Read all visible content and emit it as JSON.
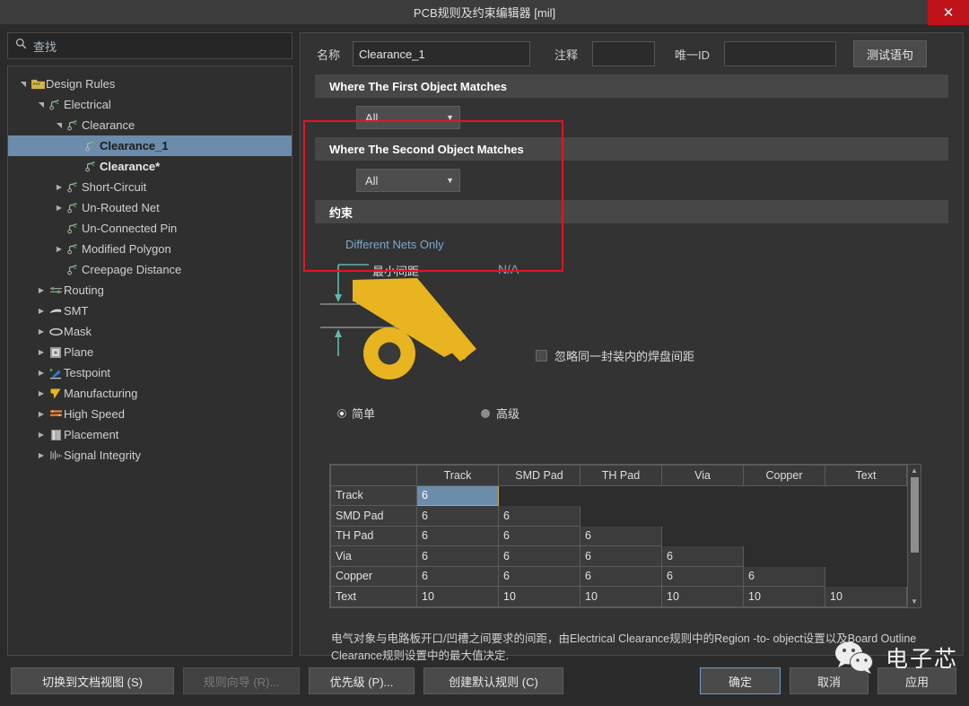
{
  "window": {
    "title": "PCB规则及约束编辑器 [mil]",
    "close_label": "✕"
  },
  "sidebar": {
    "search": {
      "placeholder": "查找",
      "value": "查找",
      "icon": "search-icon"
    },
    "tree": [
      {
        "label": "Design Rules",
        "depth": 0,
        "arrow": "down",
        "icon": "folder-icon",
        "state": "normal"
      },
      {
        "label": "Electrical",
        "depth": 1,
        "arrow": "down",
        "icon": "electrical-icon",
        "state": "normal"
      },
      {
        "label": "Clearance",
        "depth": 2,
        "arrow": "down",
        "icon": "rule-icon",
        "state": "normal"
      },
      {
        "label": "Clearance_1",
        "depth": 3,
        "arrow": "none",
        "icon": "rule-icon",
        "state": "selected"
      },
      {
        "label": "Clearance*",
        "depth": 3,
        "arrow": "none",
        "icon": "rule-icon",
        "state": "bold"
      },
      {
        "label": "Short-Circuit",
        "depth": 2,
        "arrow": "right",
        "icon": "rule-icon",
        "state": "normal"
      },
      {
        "label": "Un-Routed Net",
        "depth": 2,
        "arrow": "right",
        "icon": "rule-icon",
        "state": "normal"
      },
      {
        "label": "Un-Connected Pin",
        "depth": 2,
        "arrow": "none",
        "icon": "rule-icon",
        "state": "normal"
      },
      {
        "label": "Modified Polygon",
        "depth": 2,
        "arrow": "right",
        "icon": "rule-icon",
        "state": "normal"
      },
      {
        "label": "Creepage Distance",
        "depth": 2,
        "arrow": "none",
        "icon": "rule-icon",
        "state": "normal"
      },
      {
        "label": "Routing",
        "depth": 1,
        "arrow": "right",
        "icon": "routing-icon",
        "state": "normal"
      },
      {
        "label": "SMT",
        "depth": 1,
        "arrow": "right",
        "icon": "smt-icon",
        "state": "normal"
      },
      {
        "label": "Mask",
        "depth": 1,
        "arrow": "right",
        "icon": "mask-icon",
        "state": "normal"
      },
      {
        "label": "Plane",
        "depth": 1,
        "arrow": "right",
        "icon": "plane-icon",
        "state": "normal"
      },
      {
        "label": "Testpoint",
        "depth": 1,
        "arrow": "right",
        "icon": "testpoint-icon",
        "state": "normal"
      },
      {
        "label": "Manufacturing",
        "depth": 1,
        "arrow": "right",
        "icon": "manufacturing-icon",
        "state": "normal"
      },
      {
        "label": "High Speed",
        "depth": 1,
        "arrow": "right",
        "icon": "highspeed-icon",
        "state": "normal"
      },
      {
        "label": "Placement",
        "depth": 1,
        "arrow": "right",
        "icon": "placement-icon",
        "state": "normal"
      },
      {
        "label": "Signal Integrity",
        "depth": 1,
        "arrow": "right",
        "icon": "signal-icon",
        "state": "normal"
      }
    ]
  },
  "form": {
    "name_label": "名称",
    "name_value": "Clearance_1",
    "comment_label": "注释",
    "comment_value": "",
    "uniqueid_label": "唯一ID",
    "uniqueid_value": "",
    "test_query_button": "测试语句"
  },
  "sections": {
    "first_object": {
      "header": "Where The First Object Matches",
      "dropdown_value": "All"
    },
    "second_object": {
      "header": "Where The Second Object Matches",
      "dropdown_value": "All"
    },
    "constraint": {
      "header": "约束"
    }
  },
  "constraint": {
    "different_nets_only": "Different Nets Only",
    "min_clearance_label": "最小间距",
    "min_clearance_value": "N/A",
    "ignore_pad_checkbox": {
      "label": "忽略同一封装内的焊盘间距",
      "checked": false
    },
    "mode_radios": [
      {
        "label": "简单",
        "checked": true
      },
      {
        "label": "高级",
        "checked": false
      }
    ]
  },
  "matrix": {
    "columns": [
      "",
      "Track",
      "SMD Pad",
      "TH Pad",
      "Via",
      "Copper",
      "Text"
    ],
    "rows": [
      {
        "label": "Track",
        "cells": [
          "6",
          "",
          "",
          "",
          "",
          ""
        ]
      },
      {
        "label": "SMD Pad",
        "cells": [
          "6",
          "6",
          "",
          "",
          "",
          ""
        ]
      },
      {
        "label": "TH Pad",
        "cells": [
          "6",
          "6",
          "6",
          "",
          "",
          ""
        ]
      },
      {
        "label": "Via",
        "cells": [
          "6",
          "6",
          "6",
          "6",
          "",
          ""
        ]
      },
      {
        "label": "Copper",
        "cells": [
          "6",
          "6",
          "6",
          "6",
          "6",
          ""
        ]
      },
      {
        "label": "Text",
        "cells": [
          "10",
          "10",
          "10",
          "10",
          "10",
          "10"
        ]
      }
    ],
    "selected_cell": {
      "row": 0,
      "col": 0
    }
  },
  "description": "电气对象与电路板开口/凹槽之间要求的间距，由Electrical Clearance规则中的Region -to- object设置以及Board Outline Clearance规则设置中的最大值决定.",
  "footer": {
    "left_buttons": [
      {
        "label": "切换到文档视图 (S)",
        "disabled": false,
        "primary": false
      },
      {
        "label": "规则向导 (R)...",
        "disabled": true,
        "primary": false
      },
      {
        "label": "优先级 (P)...",
        "disabled": false,
        "primary": false
      },
      {
        "label": "创建默认规则 (C)",
        "disabled": false,
        "primary": false
      }
    ],
    "right_buttons": [
      {
        "label": "确定",
        "disabled": false,
        "primary": true
      },
      {
        "label": "取消",
        "disabled": false,
        "primary": false
      },
      {
        "label": "应用",
        "disabled": false,
        "primary": false
      }
    ]
  },
  "watermark": {
    "text": "电子芯",
    "icon": "wechat-icon"
  },
  "colors": {
    "accent_selection": "#6b8cab",
    "annotation_red": "#e81123",
    "pcb_yellow": "#e8b41f",
    "link_blue": "#7ba7cc",
    "dimension_teal": "#5fb8b0",
    "close_red": "#c0121a"
  }
}
